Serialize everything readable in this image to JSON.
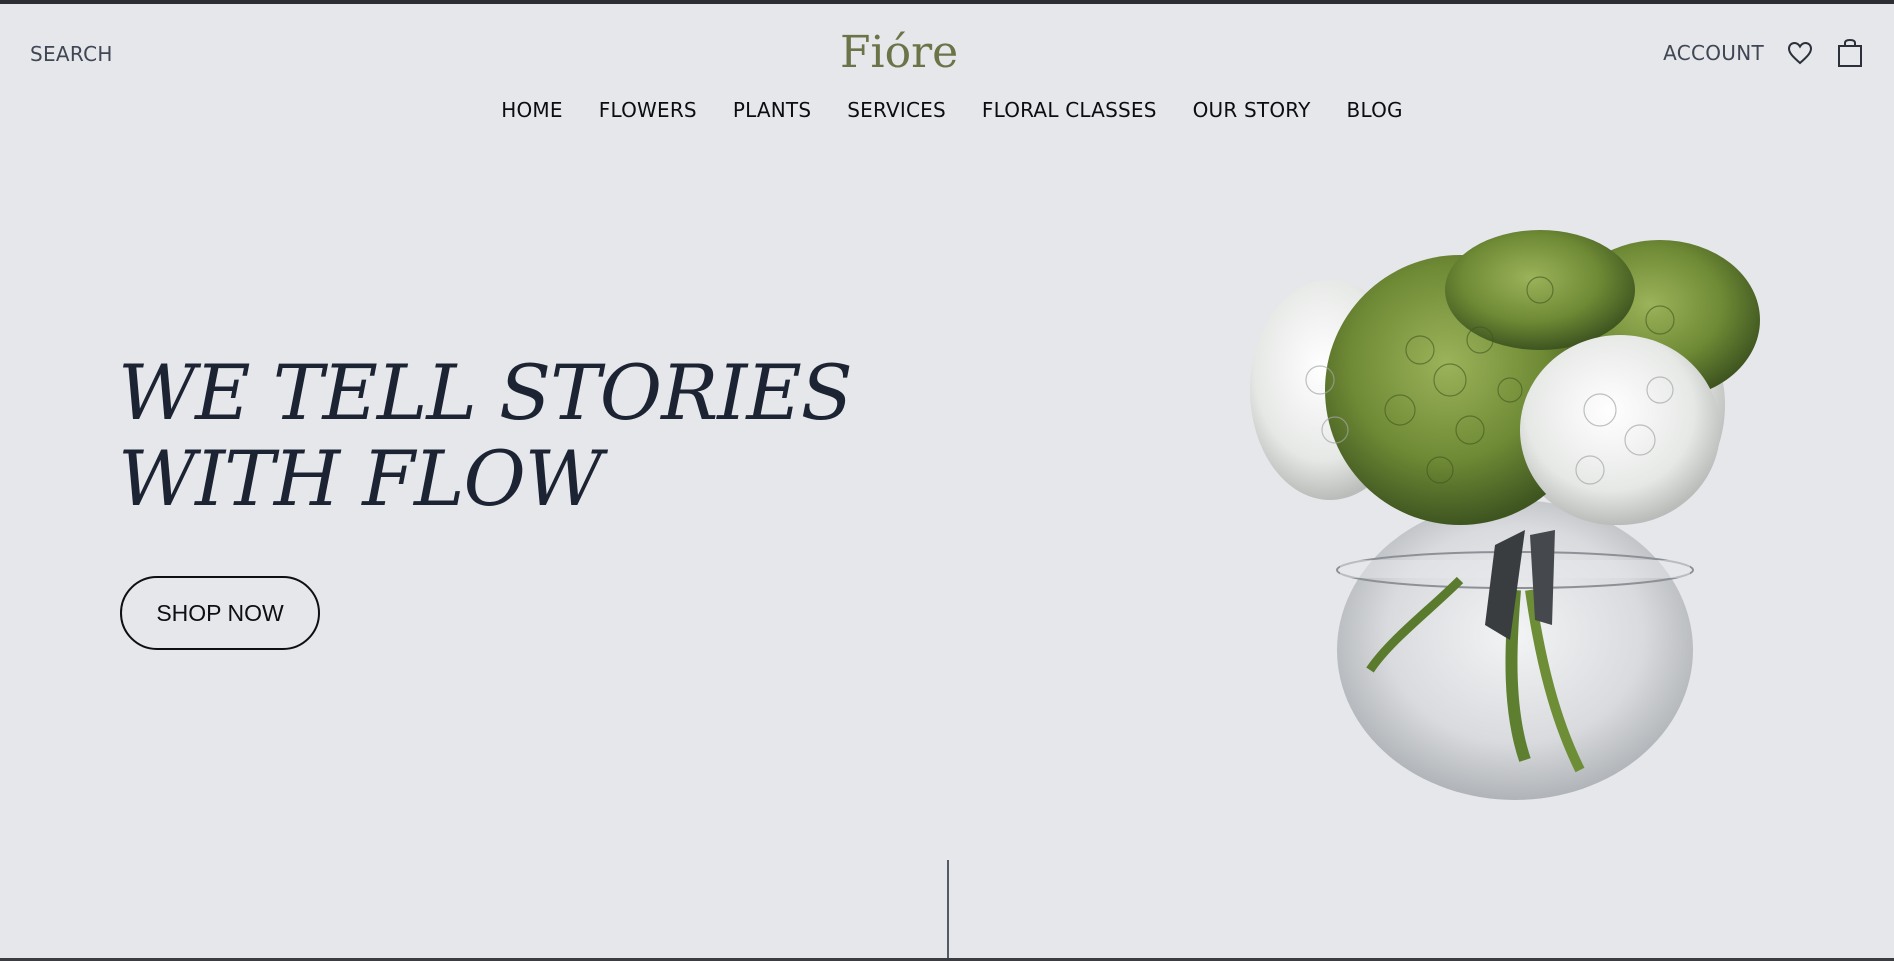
{
  "header": {
    "search_label": "SEARCH",
    "logo_text": "Fióre",
    "account_label": "ACCOUNT",
    "wishlist_icon": "heart-icon",
    "cart_icon": "shopping-bag-icon"
  },
  "nav": {
    "items": [
      {
        "label": "HOME"
      },
      {
        "label": "FLOWERS"
      },
      {
        "label": "PLANTS"
      },
      {
        "label": "SERVICES"
      },
      {
        "label": "FLORAL CLASSES"
      },
      {
        "label": "OUR STORY"
      },
      {
        "label": "BLOG"
      }
    ]
  },
  "hero": {
    "title_line1": "WE TELL STORIES",
    "title_line2": "WITH FLOW",
    "cta_label": "SHOP NOW",
    "image_subject": "hydrangea-bouquet-in-glass-vase"
  },
  "colors": {
    "background": "#e6e7eb",
    "logo": "#6b7448",
    "title": "#1c2434",
    "text": "#0a0d12"
  }
}
